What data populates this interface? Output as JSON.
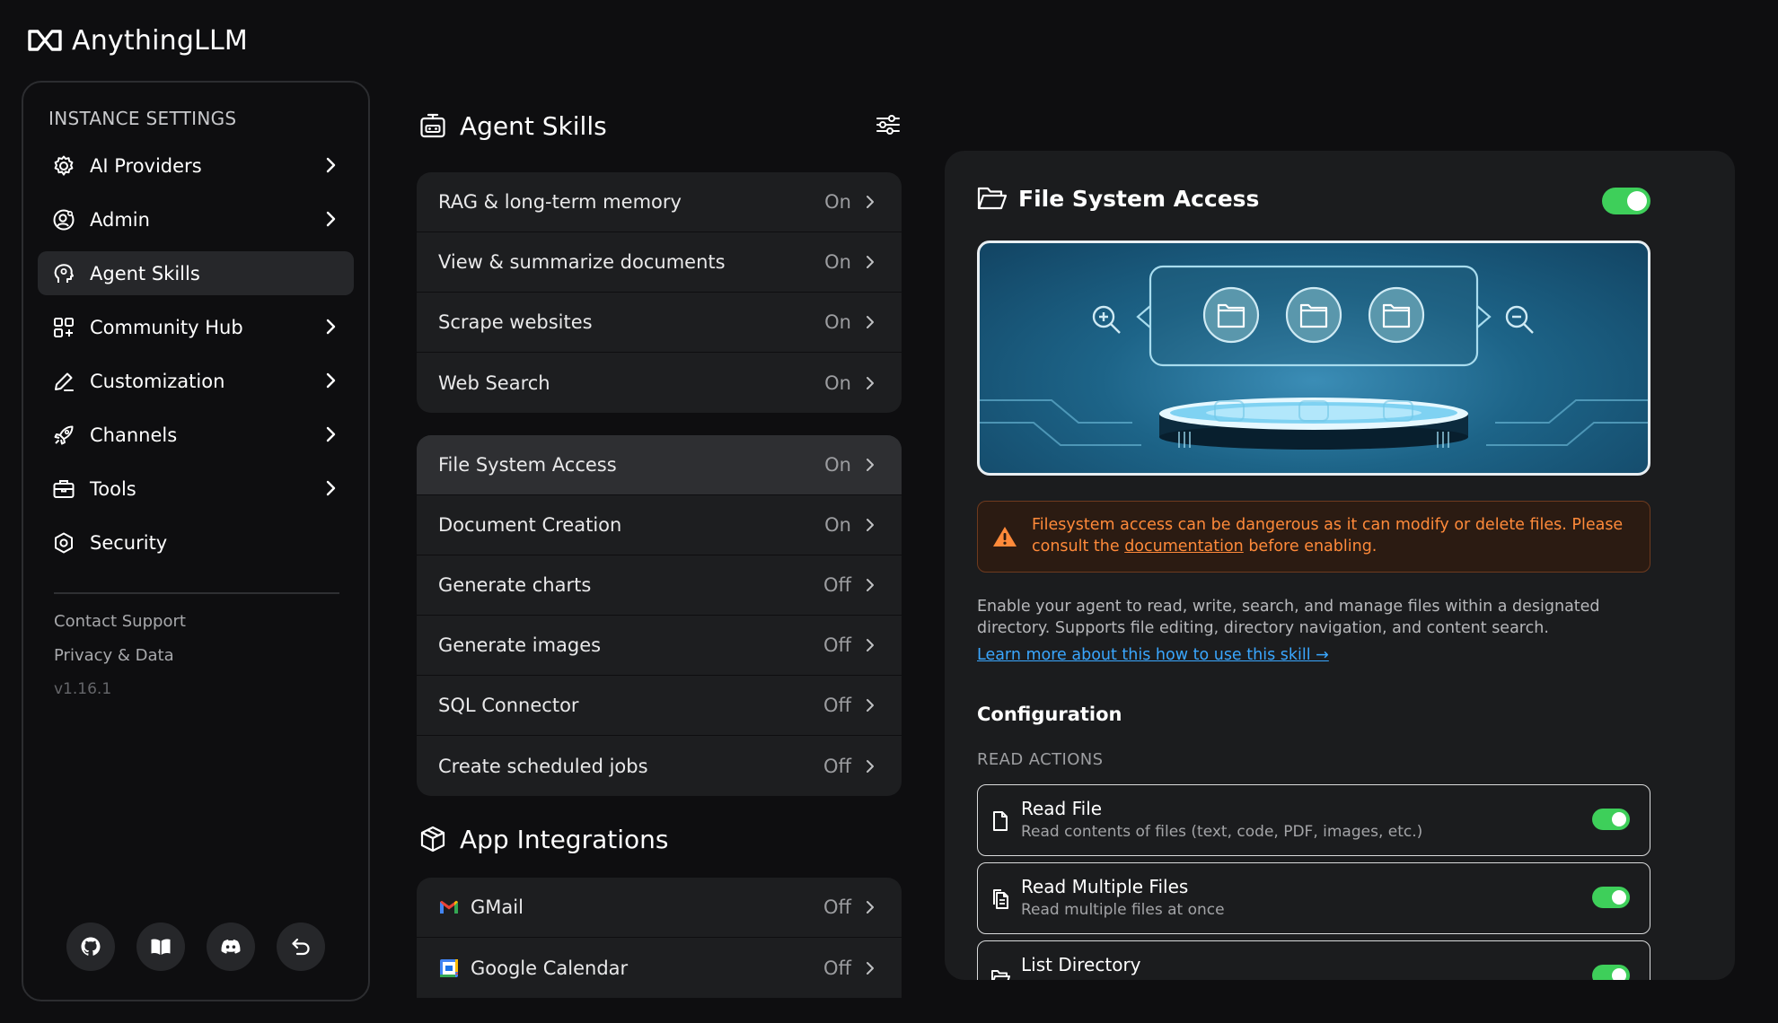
{
  "app": {
    "name": "AnythingLLM"
  },
  "sidebar": {
    "heading": "INSTANCE SETTINGS",
    "items": [
      {
        "label": "AI Providers",
        "icon": "gear-icon",
        "has_chevron": true,
        "active": false
      },
      {
        "label": "Admin",
        "icon": "user-gear-icon",
        "has_chevron": true,
        "active": false
      },
      {
        "label": "Agent Skills",
        "icon": "agent-head-icon",
        "has_chevron": false,
        "active": true
      },
      {
        "label": "Community Hub",
        "icon": "grid-icon",
        "has_chevron": true,
        "active": false
      },
      {
        "label": "Customization",
        "icon": "pencil-icon",
        "has_chevron": true,
        "active": false
      },
      {
        "label": "Channels",
        "icon": "rocket-icon",
        "has_chevron": true,
        "active": false
      },
      {
        "label": "Tools",
        "icon": "toolbox-icon",
        "has_chevron": true,
        "active": false
      },
      {
        "label": "Security",
        "icon": "shield-icon",
        "has_chevron": false,
        "active": false
      }
    ],
    "footer": {
      "contact": "Contact Support",
      "privacy": "Privacy & Data",
      "version": "v1.16.1"
    },
    "bottom_icons": [
      "github-icon",
      "book-icon",
      "discord-icon",
      "return-icon"
    ]
  },
  "agent_skills": {
    "title": "Agent Skills",
    "group1": [
      {
        "label": "RAG & long-term memory",
        "state": "On"
      },
      {
        "label": "View & summarize documents",
        "state": "On"
      },
      {
        "label": "Scrape websites",
        "state": "On"
      },
      {
        "label": "Web Search",
        "state": "On"
      }
    ],
    "group2": [
      {
        "label": "File System Access",
        "state": "On",
        "active": true
      },
      {
        "label": "Document Creation",
        "state": "On"
      },
      {
        "label": "Generate charts",
        "state": "Off"
      },
      {
        "label": "Generate images",
        "state": "Off"
      },
      {
        "label": "SQL Connector",
        "state": "Off"
      },
      {
        "label": "Create scheduled jobs",
        "state": "Off"
      }
    ]
  },
  "app_integrations": {
    "title": "App Integrations",
    "items": [
      {
        "label": "GMail",
        "state": "Off",
        "icon": "gmail-icon"
      },
      {
        "label": "Google Calendar",
        "state": "Off",
        "icon": "google-calendar-icon"
      }
    ]
  },
  "detail": {
    "title": "File System Access",
    "enabled": true,
    "warning": {
      "before": "Filesystem access can be dangerous as it can modify or delete files. Please consult the ",
      "link": "documentation",
      "after": " before enabling."
    },
    "description": "Enable your agent to read, write, search, and manage files within a designated directory. Supports file editing, directory navigation, and content search.",
    "learn_more": "Learn more about this how to use this skill →",
    "config_title": "Configuration",
    "read_actions_label": "READ ACTIONS",
    "actions": [
      {
        "name": "Read File",
        "desc": "Read contents of files (text, code, PDF, images, etc.)",
        "enabled": true
      },
      {
        "name": "Read Multiple Files",
        "desc": "Read multiple files at once",
        "enabled": true
      },
      {
        "name": "List Directory",
        "desc": "",
        "enabled": true
      }
    ]
  },
  "colors": {
    "accent_green": "#3ecf5a",
    "warning_orange": "#ff8a3a",
    "link_blue": "#3aa7ff"
  }
}
